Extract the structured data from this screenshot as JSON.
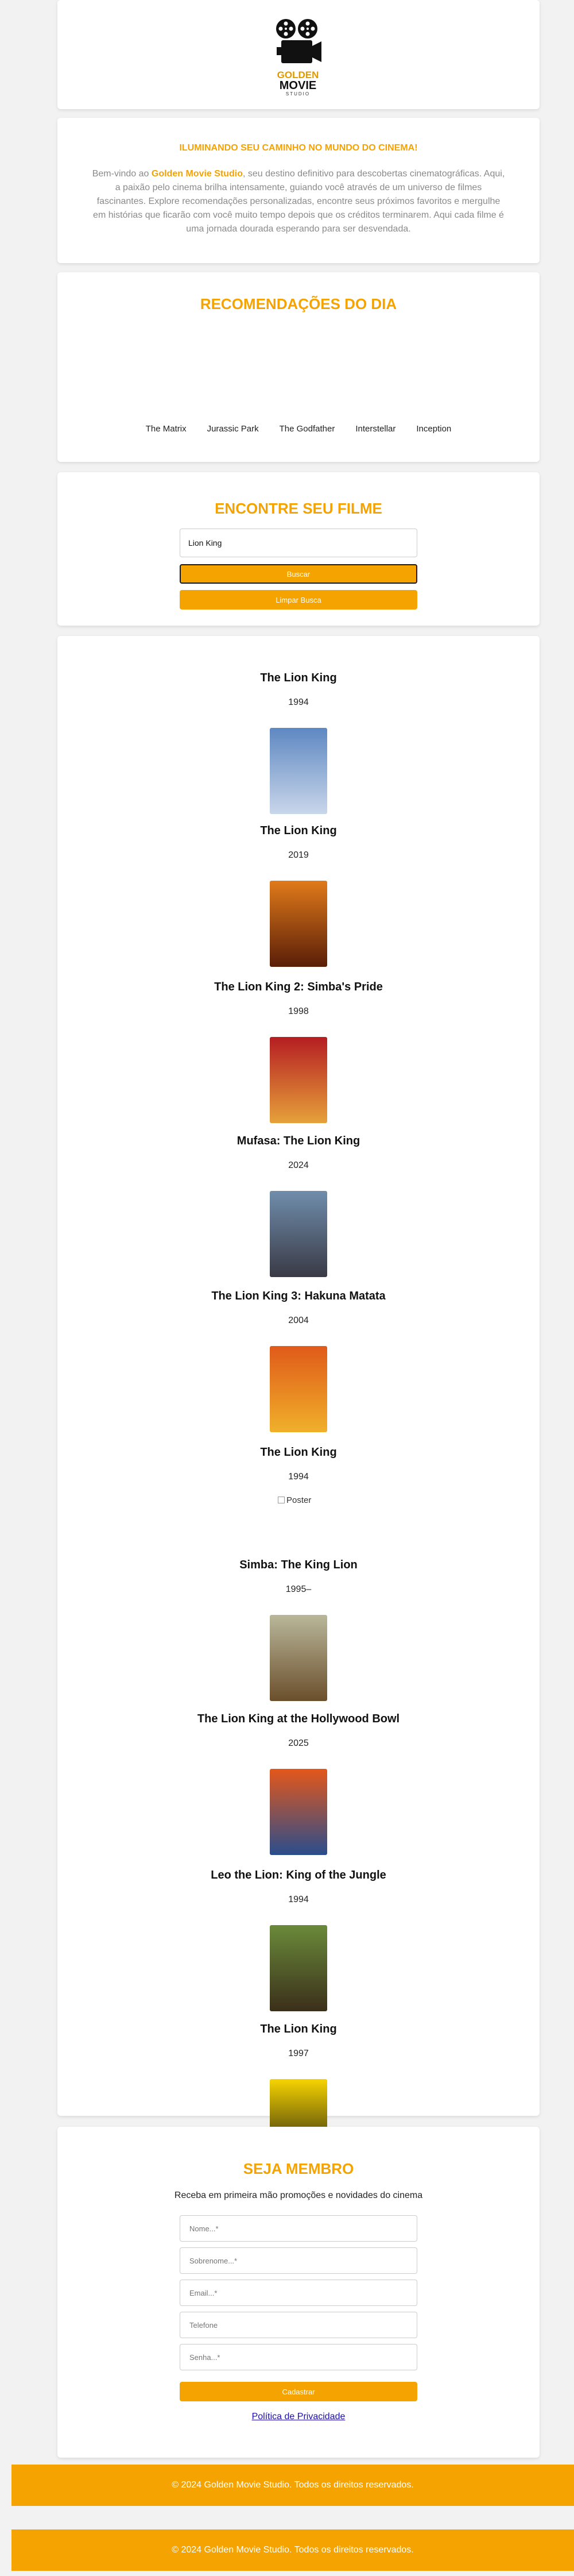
{
  "header": {
    "logo_line1": "GOLDEN",
    "logo_line2": "MOVIE",
    "logo_line3": "STUDIO"
  },
  "intro": {
    "title": "ILUMINANDO SEU CAMINHO NO MUNDO DO CINEMA!",
    "text_before": "Bem-vindo ao ",
    "brand": "Golden Movie Studio",
    "text_after": ", seu destino definitivo para descobertas cinematográficas. Aqui, a paixão pelo cinema brilha intensamente, guiando você através de um universo de filmes fascinantes. Explore recomendações personalizadas, encontre seus próximos favoritos e mergulhe em histórias que ficarão com você muito tempo depois que os créditos terminarem. Aqui cada filme é uma jornada dourada esperando para ser desvendada."
  },
  "recommendations": {
    "title": "RECOMENDAÇÕES DO DIA",
    "items": [
      "The Matrix",
      "Jurassic Park",
      "The Godfather",
      "Interstellar",
      "Inception"
    ]
  },
  "search": {
    "title": "ENCONTRE SEU FILME",
    "input_value": "Lion King",
    "search_label": "Buscar",
    "clear_label": "Limpar Busca"
  },
  "results": [
    {
      "title": "The Lion King",
      "year": "1994",
      "poster": "yes",
      "poster_colors": [
        "#5e88c2",
        "#c9d6ea"
      ]
    },
    {
      "title": "The Lion King",
      "year": "2019",
      "poster": "yes",
      "poster_colors": [
        "#e07a1a",
        "#5a1e08"
      ]
    },
    {
      "title": "The Lion King 2: Simba's Pride",
      "year": "1998",
      "poster": "yes",
      "poster_colors": [
        "#b51d22",
        "#e6a13a"
      ]
    },
    {
      "title": "Mufasa: The Lion King",
      "year": "2024",
      "poster": "yes",
      "poster_colors": [
        "#6f8dab",
        "#3a3a46"
      ]
    },
    {
      "title": "The Lion King 3: Hakuna Matata",
      "year": "2004",
      "poster": "yes",
      "poster_colors": [
        "#e05a1a",
        "#f0b02a"
      ]
    },
    {
      "title": "The Lion King",
      "year": "1994",
      "poster": "broken",
      "poster_alt": "Poster"
    },
    {
      "title": "Simba: The King Lion",
      "year": "1995–",
      "poster": "yes",
      "poster_colors": [
        "#b9b79a",
        "#6b4f2c"
      ]
    },
    {
      "title": "The Lion King at the Hollywood Bowl",
      "year": "2025",
      "poster": "yes",
      "poster_colors": [
        "#e4571a",
        "#2a4d8c"
      ]
    },
    {
      "title": "Leo the Lion: King of the Jungle",
      "year": "1994",
      "poster": "yes",
      "poster_colors": [
        "#6a8a3a",
        "#3b2f1a"
      ]
    },
    {
      "title": "The Lion King",
      "year": "1997",
      "poster": "yes",
      "poster_colors": [
        "#f7d400",
        "#111111"
      ]
    }
  ],
  "member": {
    "title": "SEJA MEMBRO",
    "subtitle": "Receba em primeira mão promoções e novidades do cinema",
    "fields": [
      "Nome...*",
      "Sobrenome...*",
      "Email...*",
      "Telefone",
      "Senha...*"
    ],
    "submit_label": "Cadastrar",
    "privacy_label": "Política de Privacidade"
  },
  "footer": {
    "text": "© 2024 Golden Movie Studio. Todos os direitos reservados."
  },
  "colors": {
    "accent": "#f5a300",
    "link": "#1a0dab"
  }
}
